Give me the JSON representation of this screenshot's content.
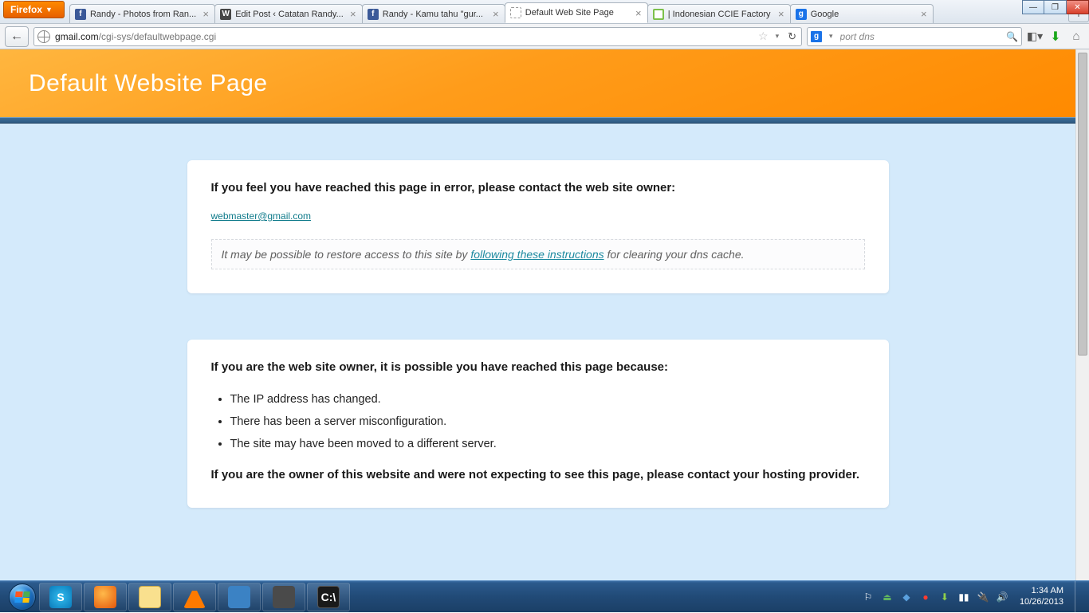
{
  "browser": {
    "menu_button": "Firefox",
    "tabs": [
      {
        "label": "Randy - Photos from Ran...",
        "favicon": "fb"
      },
      {
        "label": "Edit Post ‹ Catatan Randy...",
        "favicon": "wp"
      },
      {
        "label": "Randy - Kamu tahu \"gur...",
        "favicon": "fb"
      },
      {
        "label": "Default Web Site Page",
        "favicon": "dot",
        "active": true
      },
      {
        "label": "| Indonesian CCIE Factory",
        "favicon": "ci"
      },
      {
        "label": "Google",
        "favicon": "g"
      }
    ],
    "url_domain": "gmail.com",
    "url_path": "/cgi-sys/defaultwebpage.cgi",
    "search_value": "port dns"
  },
  "page": {
    "hero_title": "Default Website Page",
    "card1": {
      "lead": "If you feel you have reached this page in error, please contact the web site owner:",
      "email": "webmaster@gmail.com",
      "notice_pre": "It may be possible to restore access to this site by ",
      "notice_link": "following these instructions",
      "notice_post": " for clearing your dns cache."
    },
    "card2": {
      "lead": "If you are the web site owner, it is possible you have reached this page because:",
      "bullets": [
        "The IP address has changed.",
        "There has been a server misconfiguration.",
        "The site may have been moved to a different server."
      ],
      "closing": "If you are the owner of this website and were not expecting to see this page, please contact your hosting provider."
    }
  },
  "taskbar": {
    "apps": [
      "skype",
      "firefox",
      "explorer",
      "vlc",
      "devicemgr",
      "netbeans",
      "cmd"
    ],
    "clock_time": "1:34 AM",
    "clock_date": "10/26/2013"
  }
}
